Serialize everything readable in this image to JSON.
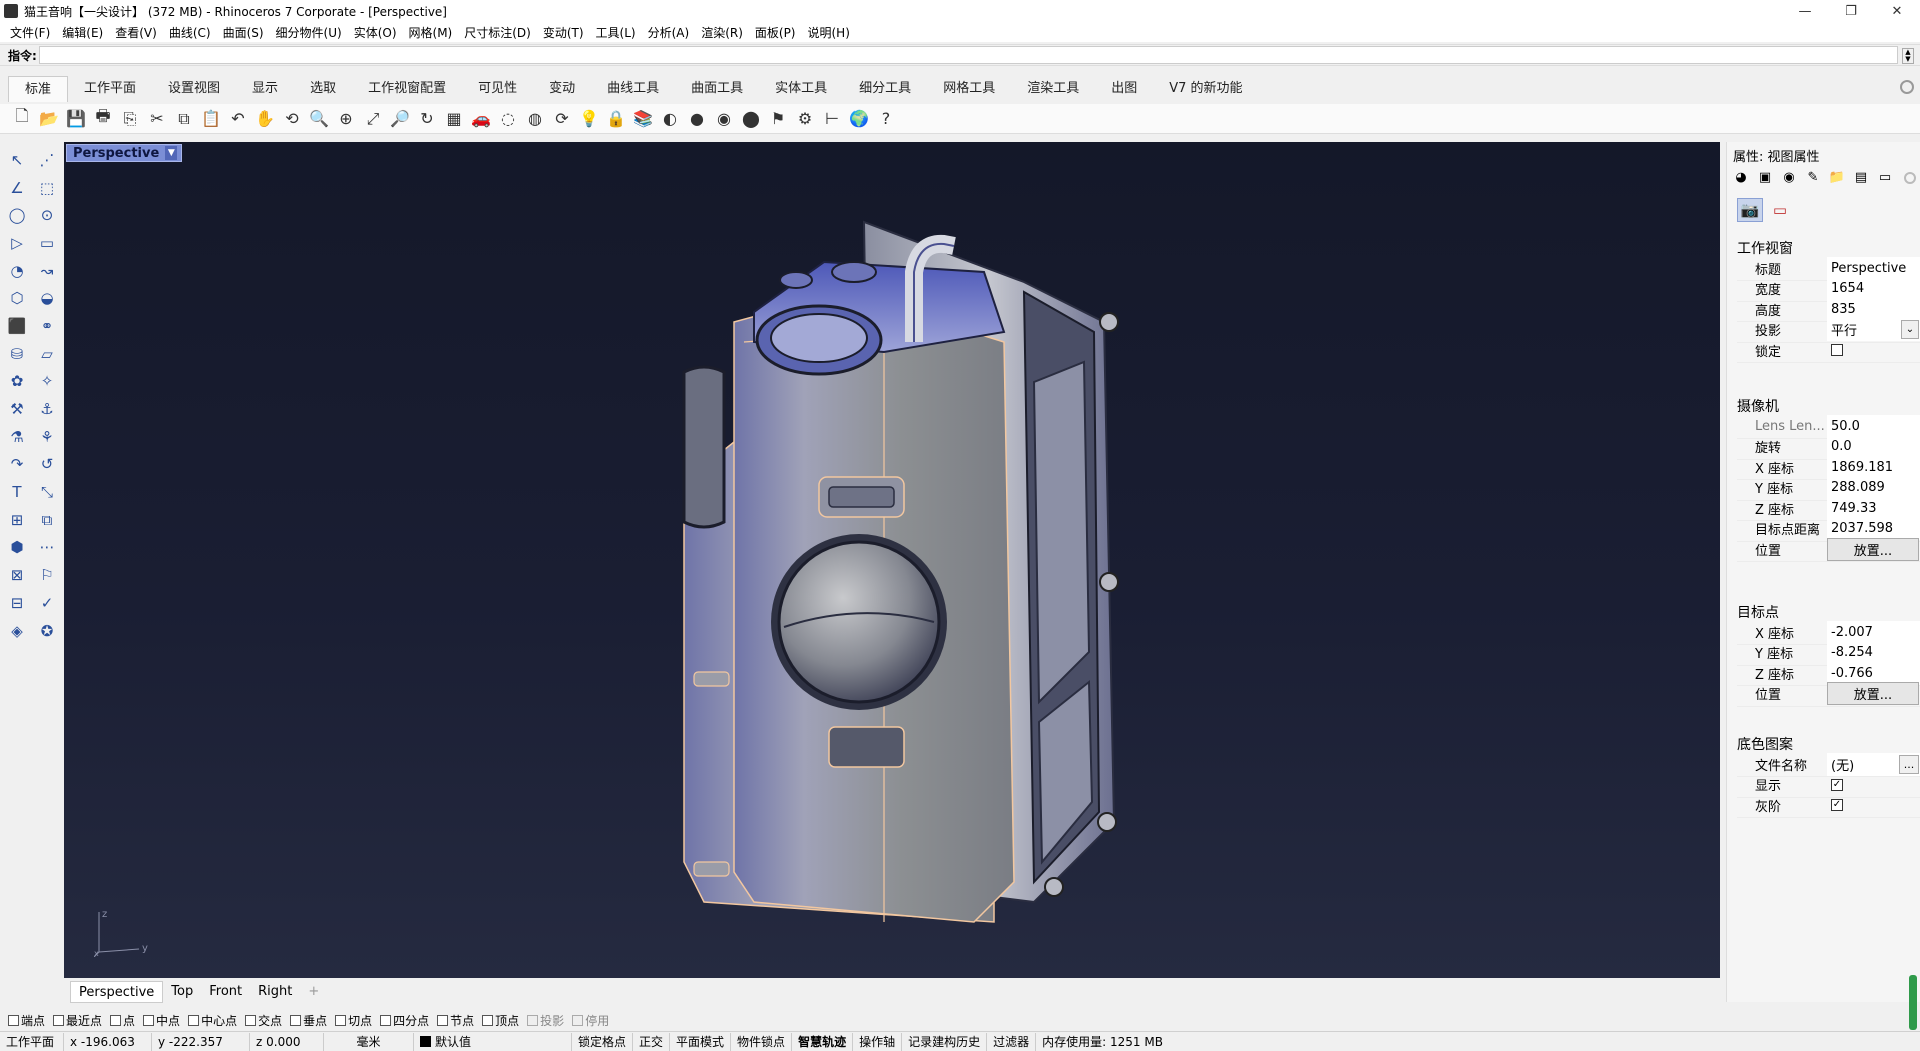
{
  "window": {
    "title": "猫王音响【一尖设计】 (372 MB) - Rhinoceros 7 Corporate - [Perspective]",
    "buttons": [
      "—",
      "❐",
      "✕"
    ]
  },
  "menu": [
    "文件(F)",
    "编辑(E)",
    "查看(V)",
    "曲线(C)",
    "曲面(S)",
    "细分物件(U)",
    "实体(O)",
    "网格(M)",
    "尺寸标注(D)",
    "变动(T)",
    "工具(L)",
    "分析(A)",
    "渲染(R)",
    "面板(P)",
    "说明(H)"
  ],
  "command": {
    "label": "指令:",
    "value": ""
  },
  "tabs": [
    "标准",
    "工作平面",
    "设置视图",
    "显示",
    "选取",
    "工作视窗配置",
    "可见性",
    "变动",
    "曲线工具",
    "曲面工具",
    "实体工具",
    "细分工具",
    "网格工具",
    "渲染工具",
    "出图",
    "V7 的新功能"
  ],
  "toolbar_icons": [
    "new-icon",
    "open-icon",
    "save-icon",
    "print-icon",
    "import-icon",
    "cut-icon",
    "copy-icon",
    "paste-icon",
    "undo-icon",
    "pan-icon",
    "rotate-view-icon",
    "zoom-icon",
    "zoom-window-icon",
    "zoom-extents-icon",
    "zoom-selected-icon",
    "rotate-icon",
    "grid-icon",
    "car-icon",
    "hide-icon",
    "show-icon",
    "snap-icon",
    "light-icon",
    "lock-icon",
    "layer-icon",
    "color-wheel-icon",
    "shaded-sphere-icon",
    "rendered-sphere-icon",
    "render-icon",
    "highlight-icon",
    "settings-gear-icon",
    "dimension-icon",
    "globe-icon",
    "help-icon"
  ],
  "toolbar_glyphs": [
    "🗋",
    "📂",
    "💾",
    "🖶",
    "⎘",
    "✂",
    "⧉",
    "📋",
    "↶",
    "✋",
    "⟲",
    "🔍",
    "⊕",
    "⤢",
    "🔎",
    "↻",
    "▦",
    "🚗",
    "◌",
    "◍",
    "⟳",
    "💡",
    "🔒",
    "📚",
    "◐",
    "●",
    "◉",
    "⬤",
    "⚑",
    "⚙",
    "⊢",
    "🌍",
    "?"
  ],
  "left_tools": [
    "↖",
    "⋰",
    "∠",
    "⬚",
    "◯",
    "⊙",
    "▷",
    "▭",
    "◔",
    "↝",
    "⬡",
    "◒",
    "⬛",
    "⚭",
    "⛁",
    "▱",
    "✿",
    "✧",
    "⚒",
    "⚓",
    "⚗",
    "⚘",
    "↷",
    "↺",
    "T",
    "⤡",
    "⊞",
    "⧉",
    "⬢",
    "⋯",
    "⊠",
    "⚐",
    "⊟",
    "✓",
    "◈",
    "✪"
  ],
  "viewport": {
    "label": "Perspective",
    "axis": {
      "z": "z",
      "y": "y",
      "x": "x"
    }
  },
  "viewport_tabs": [
    "Perspective",
    "Top",
    "Front",
    "Right",
    "+"
  ],
  "osnaps": [
    {
      "label": "端点",
      "enabled": true
    },
    {
      "label": "最近点",
      "enabled": true
    },
    {
      "label": "点",
      "enabled": true
    },
    {
      "label": "中点",
      "enabled": true
    },
    {
      "label": "中心点",
      "enabled": true
    },
    {
      "label": "交点",
      "enabled": true
    },
    {
      "label": "垂点",
      "enabled": true
    },
    {
      "label": "切点",
      "enabled": true
    },
    {
      "label": "四分点",
      "enabled": true
    },
    {
      "label": "节点",
      "enabled": true
    },
    {
      "label": "顶点",
      "enabled": true
    },
    {
      "label": "投影",
      "enabled": false
    },
    {
      "label": "停用",
      "enabled": false
    }
  ],
  "status": {
    "cplane": "工作平面",
    "x": "x -196.063",
    "y": "y -222.357",
    "z": "z 0.000",
    "units": "毫米",
    "layer": "默认值",
    "modes": [
      "锁定格点",
      "正交",
      "平面模式",
      "物件锁点",
      "智慧轨迹",
      "操作轴",
      "记录建构历史",
      "过滤器"
    ],
    "memory": "内存使用量: 1251 MB"
  },
  "panel": {
    "title": "属性: 视图属性",
    "top_icons": [
      "◕",
      "▣",
      "◉",
      "✎",
      "📁",
      "▤",
      "▭"
    ],
    "sub_icons": [
      "📷",
      "▭"
    ],
    "sections": {
      "viewport": "工作视窗",
      "camera": "摄像机",
      "target": "目标点",
      "wallpaper": "底色图案"
    },
    "viewport_rows": [
      {
        "k": "标题",
        "v": "Perspective"
      },
      {
        "k": "宽度",
        "v": "1654"
      },
      {
        "k": "高度",
        "v": "835"
      },
      {
        "k": "投影",
        "v": "平行"
      },
      {
        "k": "锁定",
        "v": ""
      }
    ],
    "camera_rows": [
      {
        "k": "Lens Len...",
        "v": "50.0"
      },
      {
        "k": "旋转",
        "v": "0.0"
      },
      {
        "k": "X 座标",
        "v": "1869.181"
      },
      {
        "k": "Y 座标",
        "v": "288.089"
      },
      {
        "k": "Z 座标",
        "v": "749.33"
      },
      {
        "k": "目标点距离",
        "v": "2037.598"
      },
      {
        "k": "位置",
        "v": "放置..."
      }
    ],
    "target_rows": [
      {
        "k": "X 座标",
        "v": "-2.007"
      },
      {
        "k": "Y 座标",
        "v": "-8.254"
      },
      {
        "k": "Z 座标",
        "v": "-0.766"
      },
      {
        "k": "位置",
        "v": "放置..."
      }
    ],
    "wallpaper_rows": [
      {
        "k": "文件名称",
        "v": "(无)"
      },
      {
        "k": "显示",
        "v": "✓"
      },
      {
        "k": "灰阶",
        "v": "✓"
      }
    ],
    "ellipsis": "..."
  }
}
